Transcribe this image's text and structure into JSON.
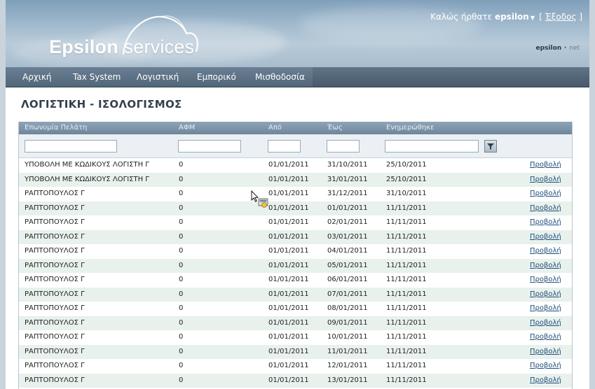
{
  "header": {
    "logo_bold": "Epsilon",
    "logo_light": " services",
    "welcome_prefix": "Καλώς ήρθατε ",
    "username": "epsilon",
    "logout_open": "[ ",
    "logout_label": "Έξοδος",
    "logout_close": " ]",
    "brand_small_bold": "epsilon",
    "brand_small_rest": " • net"
  },
  "nav": {
    "items": [
      "Αρχική",
      "Tax System",
      "Λογιστική",
      "Εμπορικό",
      "Μισθοδοσία"
    ]
  },
  "page": {
    "title": "ΛΟΓΙΣΤΙΚΗ - ΙΣΟΛΟΓΙΣΜΟΣ"
  },
  "grid": {
    "columns": [
      "Επωνυμία Πελάτη",
      "ΑΦΜ",
      "Από",
      "Έως",
      "Ενημερώθηκε"
    ],
    "view_label": "Προβολή",
    "rows": [
      [
        "ΥΠΟΒΟΛΗ ΜΕ ΚΩΔΙΚΟΥΣ ΛΟΓΙΣΤΗ Γ",
        "0",
        "01/01/2011",
        "31/10/2011",
        "25/10/2011"
      ],
      [
        "ΥΠΟΒΟΛΗ ΜΕ ΚΩΔΙΚΟΥΣ ΛΟΓΙΣΤΗ Γ",
        "0",
        "01/01/2011",
        "31/01/2011",
        "25/10/2011"
      ],
      [
        "ΡΑΠΤΟΠΟΥΛΟΣ Γ",
        "0",
        "01/01/2011",
        "31/12/2011",
        "31/10/2011"
      ],
      [
        "ΡΑΠΤΟΠΟΥΛΟΣ Γ",
        "0",
        "01/01/2011",
        "01/01/2011",
        "11/11/2011"
      ],
      [
        "ΡΑΠΤΟΠΟΥΛΟΣ Γ",
        "0",
        "01/01/2011",
        "02/01/2011",
        "11/11/2011"
      ],
      [
        "ΡΑΠΤΟΠΟΥΛΟΣ Γ",
        "0",
        "01/01/2011",
        "03/01/2011",
        "11/11/2011"
      ],
      [
        "ΡΑΠΤΟΠΟΥΛΟΣ Γ",
        "0",
        "01/01/2011",
        "04/01/2011",
        "11/11/2011"
      ],
      [
        "ΡΑΠΤΟΠΟΥΛΟΣ Γ",
        "0",
        "01/01/2011",
        "05/01/2011",
        "11/11/2011"
      ],
      [
        "ΡΑΠΤΟΠΟΥΛΟΣ Γ",
        "0",
        "01/01/2011",
        "06/01/2011",
        "11/11/2011"
      ],
      [
        "ΡΑΠΤΟΠΟΥΛΟΣ Γ",
        "0",
        "01/01/2011",
        "07/01/2011",
        "11/11/2011"
      ],
      [
        "ΡΑΠΤΟΠΟΥΛΟΣ Γ",
        "0",
        "01/01/2011",
        "08/01/2011",
        "11/11/2011"
      ],
      [
        "ΡΑΠΤΟΠΟΥΛΟΣ Γ",
        "0",
        "01/01/2011",
        "09/01/2011",
        "11/11/2011"
      ],
      [
        "ΡΑΠΤΟΠΟΥΛΟΣ Γ",
        "0",
        "01/01/2011",
        "10/01/2011",
        "11/11/2011"
      ],
      [
        "ΡΑΠΤΟΠΟΥΛΟΣ Γ",
        "0",
        "01/01/2011",
        "11/01/2011",
        "11/11/2011"
      ],
      [
        "ΡΑΠΤΟΠΟΥΛΟΣ Γ",
        "0",
        "01/01/2011",
        "12/01/2011",
        "11/11/2011"
      ],
      [
        "ΡΑΠΤΟΠΟΥΛΟΣ Γ",
        "0",
        "01/01/2011",
        "13/01/2011",
        "11/11/2011"
      ]
    ]
  },
  "colors": {
    "nav_bg": "#52667a",
    "grid_header": "#7d94a9",
    "row_alt": "#e8f1ec",
    "link": "#1d4d7a",
    "title": "#33404d"
  },
  "icons": {
    "filter": "funnel-icon",
    "cursor": "busy-cursor-icon",
    "user_menu": "caret-down-icon"
  }
}
